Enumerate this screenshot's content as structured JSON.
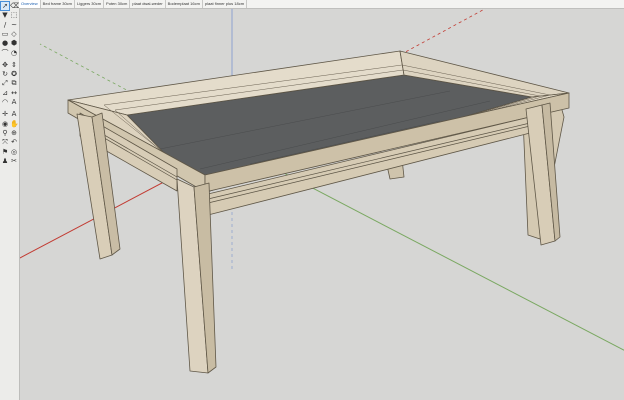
{
  "tabs": [
    {
      "label": "Overview"
    },
    {
      "label": "Bed frame 30cm"
    },
    {
      "label": "Liggers 30cm"
    },
    {
      "label": "Poten 30cm"
    },
    {
      "label": "plaat dwal-weder"
    },
    {
      "label": "Bodemplaat 16cm"
    },
    {
      "label": "plaat finner plus 18cm"
    }
  ],
  "active_tab_index": 0,
  "toolbar": {
    "tools": [
      {
        "icon": "select-arrow-icon",
        "glyph": "➚"
      },
      {
        "icon": "eraser-icon",
        "glyph": "⌫"
      },
      {
        "icon": "paint-bucket-icon",
        "glyph": "▼"
      },
      {
        "icon": "component-icon",
        "glyph": "⬚"
      },
      {
        "icon": "line-pencil-icon",
        "glyph": "/"
      },
      {
        "icon": "freehand-icon",
        "glyph": "~"
      },
      {
        "icon": "rectangle-icon",
        "glyph": "▭"
      },
      {
        "icon": "rotated-rectangle-icon",
        "glyph": "◇"
      },
      {
        "icon": "circle-icon",
        "glyph": "●"
      },
      {
        "icon": "polygon-icon",
        "glyph": "⬢"
      },
      {
        "icon": "arc-icon",
        "glyph": "⌒"
      },
      {
        "icon": "pie-icon",
        "glyph": "◔"
      },
      {
        "icon": "move-icon",
        "glyph": "✥"
      },
      {
        "icon": "push-pull-icon",
        "glyph": "⇕"
      },
      {
        "icon": "rotate-icon",
        "glyph": "↻"
      },
      {
        "icon": "follow-me-icon",
        "glyph": "✪"
      },
      {
        "icon": "scale-icon",
        "glyph": "⤢"
      },
      {
        "icon": "offset-icon",
        "glyph": "⧉"
      },
      {
        "icon": "tape-measure-icon",
        "glyph": "⊿"
      },
      {
        "icon": "dimension-icon",
        "glyph": "↔"
      },
      {
        "icon": "protractor-icon",
        "glyph": "◠"
      },
      {
        "icon": "text-icon",
        "glyph": "A"
      },
      {
        "icon": "axes-icon",
        "glyph": "✛"
      },
      {
        "icon": "3d-text-icon",
        "glyph": "A"
      },
      {
        "icon": "orbit-icon",
        "glyph": "◉"
      },
      {
        "icon": "pan-icon",
        "glyph": "✋"
      },
      {
        "icon": "zoom-icon",
        "glyph": "⚲"
      },
      {
        "icon": "zoom-window-icon",
        "glyph": "⊕"
      },
      {
        "icon": "zoom-extents-icon",
        "glyph": "⤧"
      },
      {
        "icon": "previous-view-icon",
        "glyph": "↶"
      },
      {
        "icon": "position-camera-icon",
        "glyph": "⚑"
      },
      {
        "icon": "look-around-icon",
        "glyph": "◎"
      },
      {
        "icon": "walk-icon",
        "glyph": "♟"
      },
      {
        "icon": "section-plane-icon",
        "glyph": "✂"
      }
    ]
  },
  "colors": {
    "background": "#d6d6d4",
    "wood_light": "#e4dccb",
    "wood_mid": "#d7ccb6",
    "wood_dark": "#c4b89e",
    "wood_edge": "#5f5747",
    "glass": "#5c5e5f",
    "axis_red": "#c23b32",
    "axis_green": "#7aa861",
    "axis_blue": "#8fa3cf"
  }
}
